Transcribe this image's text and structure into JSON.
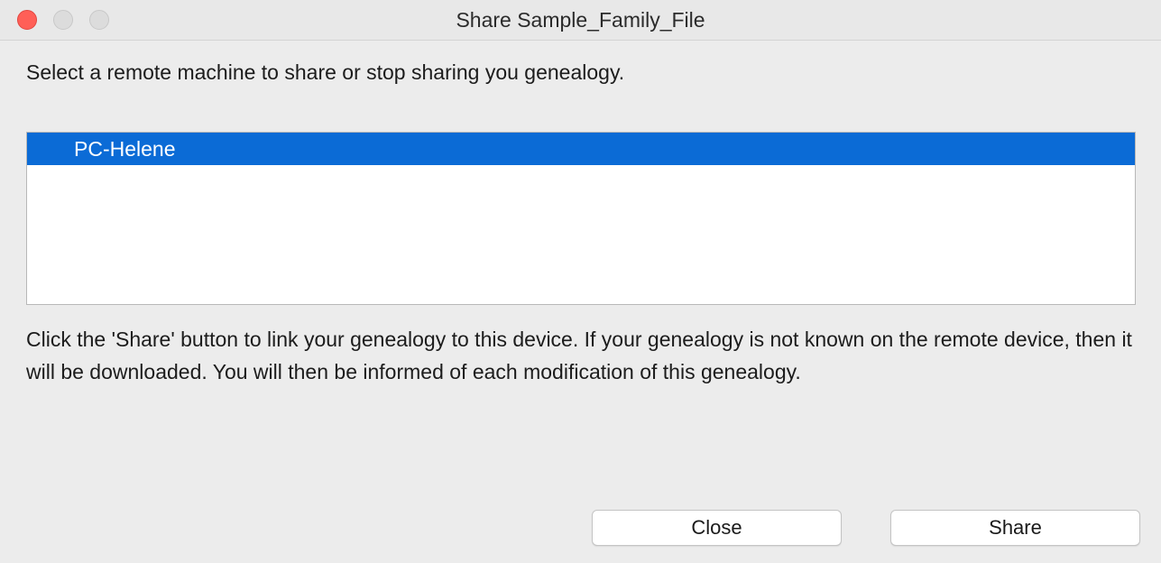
{
  "window": {
    "title": "Share Sample_Family_File"
  },
  "prompt": "Select a remote machine to share or stop sharing you genealogy.",
  "machines": [
    {
      "label": "PC-Helene",
      "selected": true
    }
  ],
  "info": "Click the 'Share' button to link your genealogy to this device. If your genealogy is not known on the remote device, then it will be downloaded. You will then be informed of each modification of this genealogy.",
  "buttons": {
    "close_label": "Close",
    "share_label": "Share"
  },
  "colors": {
    "selection": "#0b6bd6",
    "close_light": "#ff5f57",
    "window_bg": "#ececec"
  }
}
